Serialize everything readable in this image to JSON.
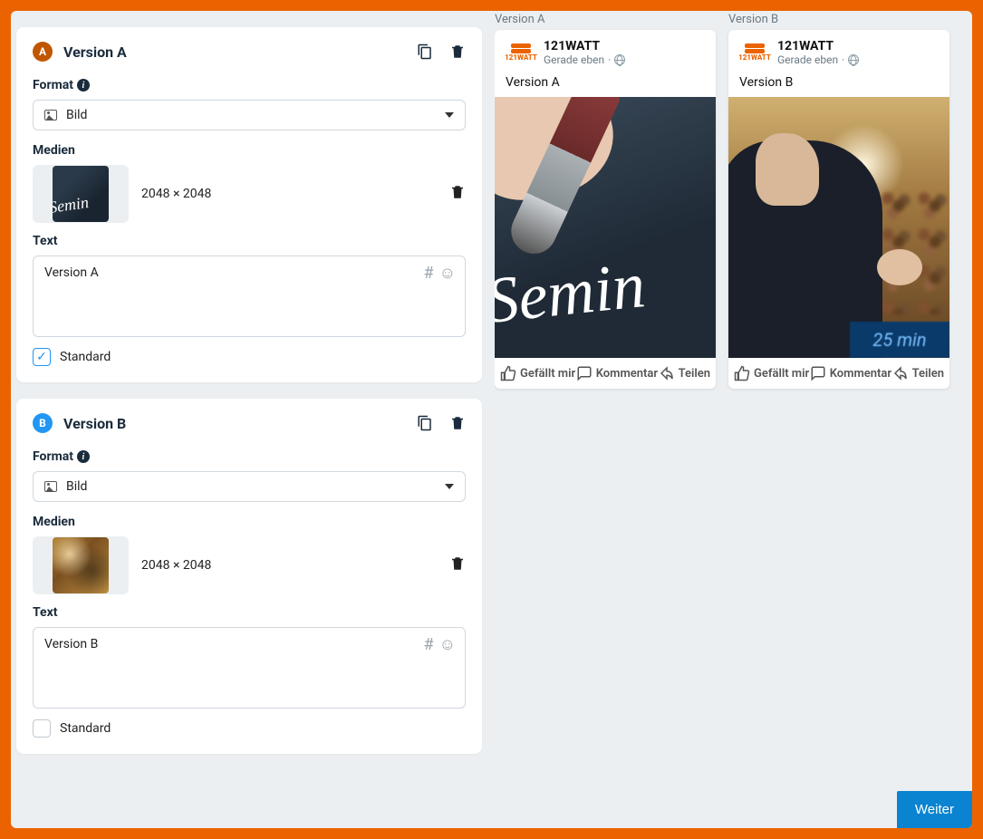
{
  "labels": {
    "format": "Format",
    "medien": "Medien",
    "text": "Text",
    "standard": "Standard",
    "next": "Weiter"
  },
  "select": {
    "value": "Bild"
  },
  "versions": {
    "a": {
      "badge": "A",
      "title": "Version A",
      "dimensions": "2048 × 2048",
      "text_value": "Version A",
      "standard_checked": true
    },
    "b": {
      "badge": "B",
      "title": "Version B",
      "dimensions": "2048 × 2048",
      "text_value": "Version B",
      "standard_checked": false
    }
  },
  "preview": {
    "account_name": "121WATT",
    "time_meta": "Gerade eben",
    "a": {
      "label": "Version A",
      "text": "Version A"
    },
    "b": {
      "label": "Version B",
      "text": "Version B",
      "screen_text": "25 min"
    },
    "actions": {
      "like": "Gefällt mir",
      "comment": "Kommentar",
      "share": "Teilen"
    },
    "script_text": "Semin"
  }
}
